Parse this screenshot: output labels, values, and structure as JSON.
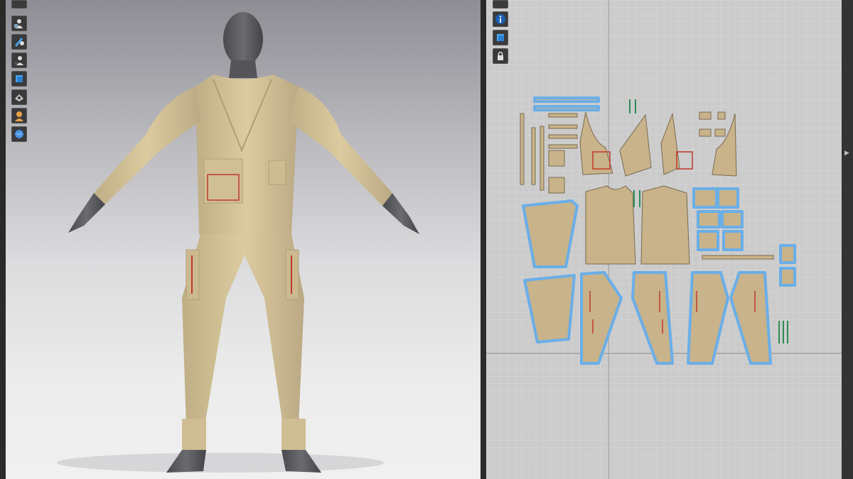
{
  "app": {
    "accent": "#5aa0e0",
    "fabric_color": "#d8c7a0",
    "pattern_fill": "#c8b38a",
    "selection_outline": "#6aaee8",
    "stitch_color": "#c0392b"
  },
  "toolbar_3d": {
    "tools": [
      {
        "icon": "view-icon"
      },
      {
        "icon": "avatar-display-icon"
      },
      {
        "icon": "texture-brush-icon"
      },
      {
        "icon": "avatar-visibility-icon"
      },
      {
        "icon": "garment-display-icon"
      },
      {
        "icon": "render-camera-icon"
      },
      {
        "icon": "avatar-skin-icon"
      },
      {
        "icon": "globe-world-icon"
      }
    ]
  },
  "toolbar_2d": {
    "tools": [
      {
        "icon": "view-icon"
      },
      {
        "icon": "info-icon"
      },
      {
        "icon": "pattern-display-icon"
      },
      {
        "icon": "lock-icon"
      }
    ]
  }
}
